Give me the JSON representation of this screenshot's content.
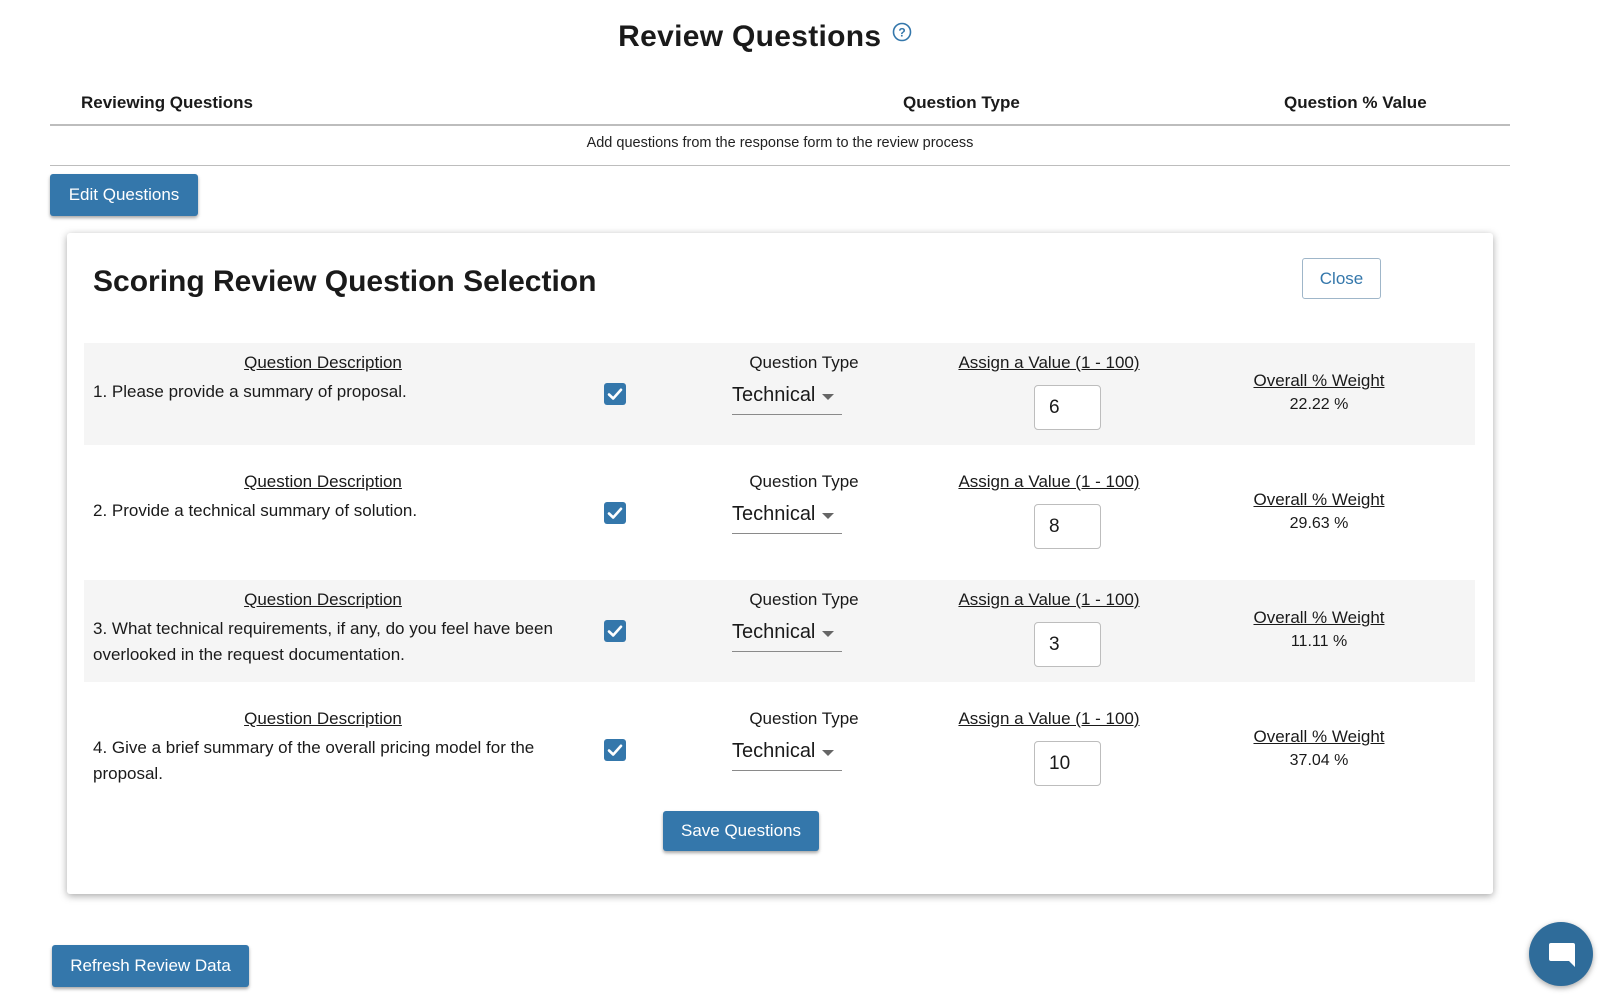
{
  "page": {
    "title": "Review Questions",
    "help_icon": "question-circle-icon"
  },
  "summary_table": {
    "headers": [
      "Reviewing Questions",
      "Question Type",
      "Question % Value"
    ],
    "empty_message": "Add questions from the response form to the review process"
  },
  "buttons": {
    "edit": "Edit Questions",
    "save": "Save Questions",
    "refresh": "Refresh Review Data",
    "close": "Close"
  },
  "panel": {
    "title": "Scoring Review Question Selection",
    "labels": {
      "description": "Question Description",
      "type": "Question Type",
      "value": "Assign a Value (1 - 100)",
      "weight": "Overall % Weight"
    },
    "questions": [
      {
        "text": "1. Please provide a summary of proposal.",
        "checked": true,
        "type": "Technical",
        "value": "6",
        "weight": "22.22 %"
      },
      {
        "text": "2. Provide a technical summary of solution.",
        "checked": true,
        "type": "Technical",
        "value": "8",
        "weight": "29.63 %"
      },
      {
        "text": "3. What technical requirements, if any, do you feel have been overlooked in the request documentation.",
        "checked": true,
        "type": "Technical",
        "value": "3",
        "weight": "11.11 %"
      },
      {
        "text": "4. Give a brief summary of the overall pricing model for the proposal.",
        "checked": true,
        "type": "Technical",
        "value": "10",
        "weight": "37.04 %"
      }
    ]
  },
  "colors": {
    "accent": "#3477ab",
    "row_shade": "#f5f5f5",
    "chat_bubble": "#2f6c9a"
  },
  "chat": {
    "icon": "chat-bubble-icon"
  }
}
